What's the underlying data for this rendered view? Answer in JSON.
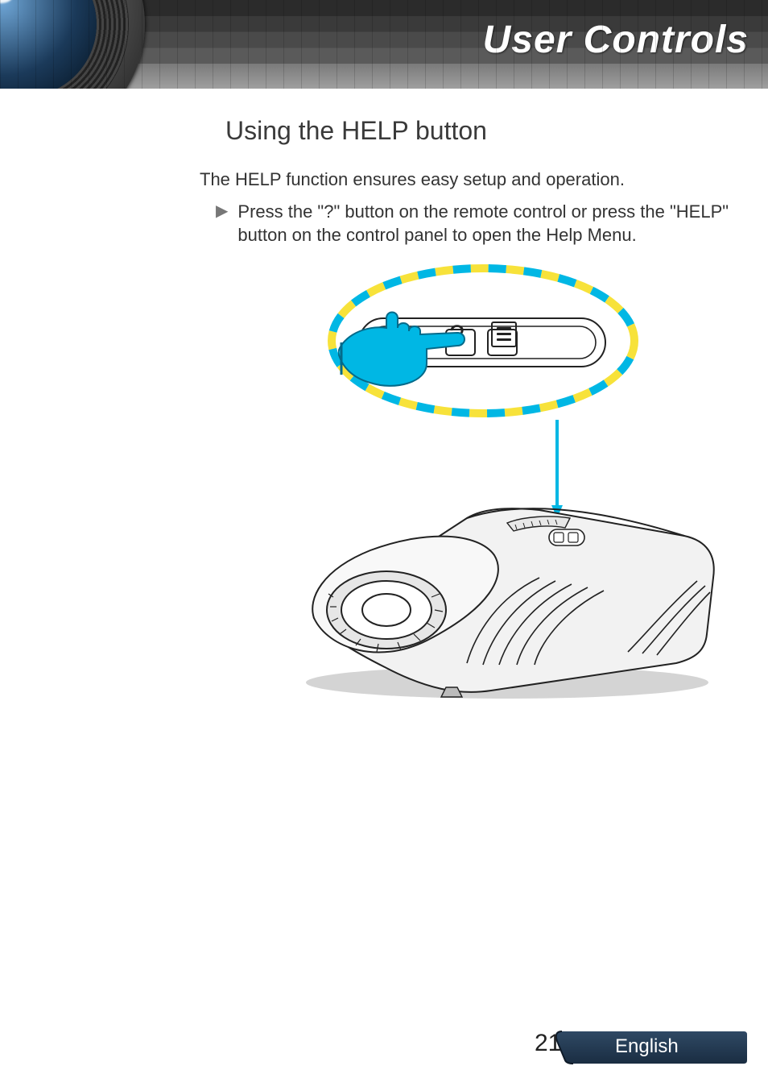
{
  "header": {
    "title": "User Controls"
  },
  "section": {
    "heading": "Using the HELP button",
    "intro": "The HELP function ensures easy setup and operation.",
    "bullet": "Press the \"?\" button on the remote control or press the \"HELP\" button on the control panel to open the Help Menu."
  },
  "figure": {
    "help_glyph": "?",
    "icon_name": "menu-list-icon"
  },
  "footer": {
    "page_number": "21",
    "language": "English"
  }
}
